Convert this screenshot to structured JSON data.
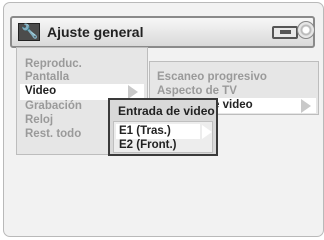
{
  "header": {
    "title": "Ajuste general",
    "left_icon": "wrench-icon",
    "right_icons": [
      "card-icon",
      "disc-icon"
    ]
  },
  "menu": {
    "items": [
      {
        "label": "Reproduc."
      },
      {
        "label": "Pantalla"
      },
      {
        "label": "Video",
        "selected": true
      },
      {
        "label": "Grabación"
      },
      {
        "label": "Reloj"
      },
      {
        "label": "Rest. todo"
      }
    ]
  },
  "submenu": {
    "items": [
      {
        "label": "Escaneo progresivo"
      },
      {
        "label": "Aspecto de TV"
      },
      {
        "label": "Entrada de video",
        "selected": true
      }
    ]
  },
  "popup": {
    "title": "Entrada de video",
    "options": [
      {
        "label": "E1 (Tras.)",
        "selected": true
      },
      {
        "label": "E2 (Front.)"
      }
    ]
  }
}
